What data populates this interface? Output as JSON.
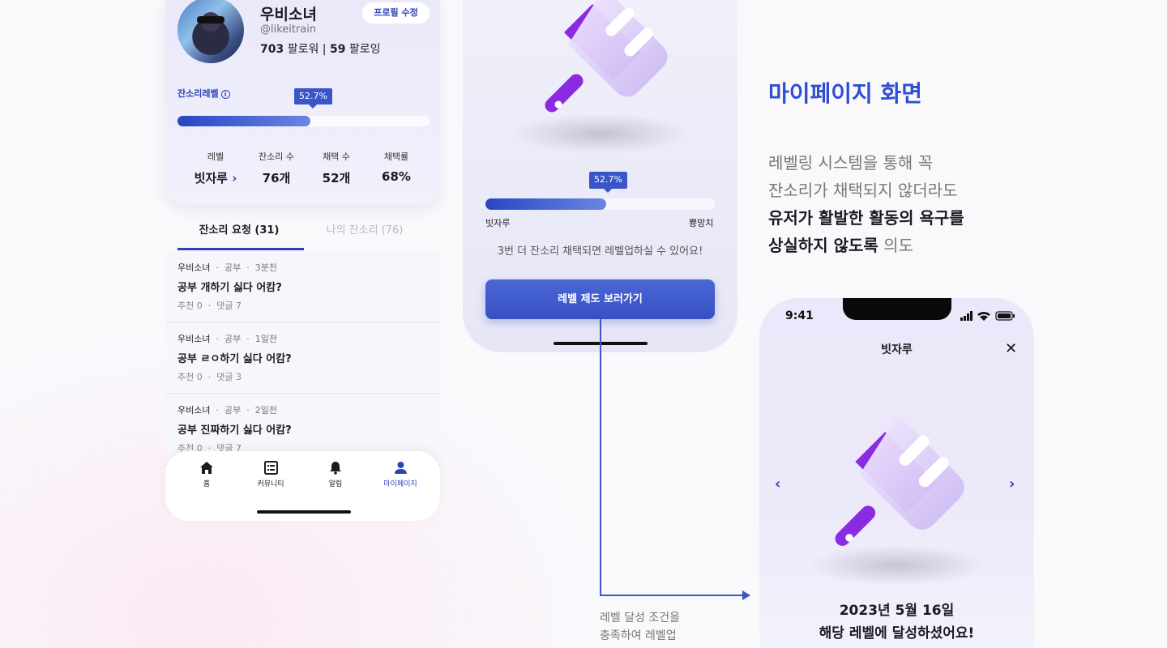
{
  "profile": {
    "name": "우비소녀",
    "handle": "@likeitrain",
    "followers_count": "703",
    "followers_label": "팔로워",
    "separator": "|",
    "following_count": "59",
    "following_label": "팔로잉",
    "edit_button": "프로필 수정"
  },
  "level_section": {
    "title": "잔소리레벨",
    "info_icon": "info-icon",
    "progress_label": "52.7%",
    "progress_value": 0.527,
    "stats": [
      {
        "label": "레벨",
        "value": "빗자루",
        "chevron": "›"
      },
      {
        "label": "잔소리 수",
        "value": "76개"
      },
      {
        "label": "채택 수",
        "value": "52개"
      },
      {
        "label": "채택률",
        "value": "68%"
      }
    ]
  },
  "tabs": [
    {
      "label": "잔소리 요청 (31)",
      "active": true
    },
    {
      "label": "나의 잔소리 (76)",
      "active": false
    }
  ],
  "posts": [
    {
      "author": "우비소녀",
      "category": "공부",
      "time": "3분전",
      "title": "공부 개하기 싫다 어캄?",
      "likes": "추천 0",
      "comments": "댓글 7"
    },
    {
      "author": "우비소녀",
      "category": "공부",
      "time": "1일전",
      "title": "공부 ㄹㅇ하기 싫다 어캄?",
      "likes": "추천 0",
      "comments": "댓글 3"
    },
    {
      "author": "우비소녀",
      "category": "공부",
      "time": "2일전",
      "title": "공부 진짜하기 싫다 어캄?",
      "likes": "추천 0",
      "comments": "댓글 7"
    }
  ],
  "meta_dot": "·",
  "bottom_nav": [
    {
      "label": "홈",
      "icon": "home-icon",
      "active": false
    },
    {
      "label": "커뮤니티",
      "icon": "list-icon",
      "active": false
    },
    {
      "label": "알림",
      "icon": "bell-icon",
      "active": false
    },
    {
      "label": "마이페이지",
      "icon": "person-icon",
      "active": true
    }
  ],
  "level_detail": {
    "progress_label": "52.7%",
    "progress_value": 0.527,
    "left_label": "빗자루",
    "right_label": "뿅망치",
    "hint": "3번 더 잔소리 채택되면 레벨업하실 수 있어요!",
    "button": "레벨 제도 보러가기"
  },
  "connector_note": {
    "line1": "레벨 달성 조건을",
    "line2": "충족하여 레벨업"
  },
  "description": {
    "title": "마이페이지 화면",
    "line1": "레벨링 시스템을 통해 꼭",
    "line2": "잔소리가 채택되지 않더라도",
    "line3": "유저가 활발한 활동의 욕구를",
    "line4_bold": "상실하지 않도록",
    "line4_rest": " 의도"
  },
  "level_modal": {
    "status_time": "9:41",
    "title": "빗자루",
    "close_icon": "close-icon",
    "prev_icon": "chevron-left-icon",
    "next_icon": "chevron-right-icon",
    "date": "2023년 5월 16일",
    "message": "해당 레벨에 달성하셨어요!"
  },
  "colors": {
    "accent": "#2c43b8",
    "title_blue": "#2f4ed2",
    "broom_purple": "#8a2be2",
    "button_blue": "#3e58cb"
  }
}
